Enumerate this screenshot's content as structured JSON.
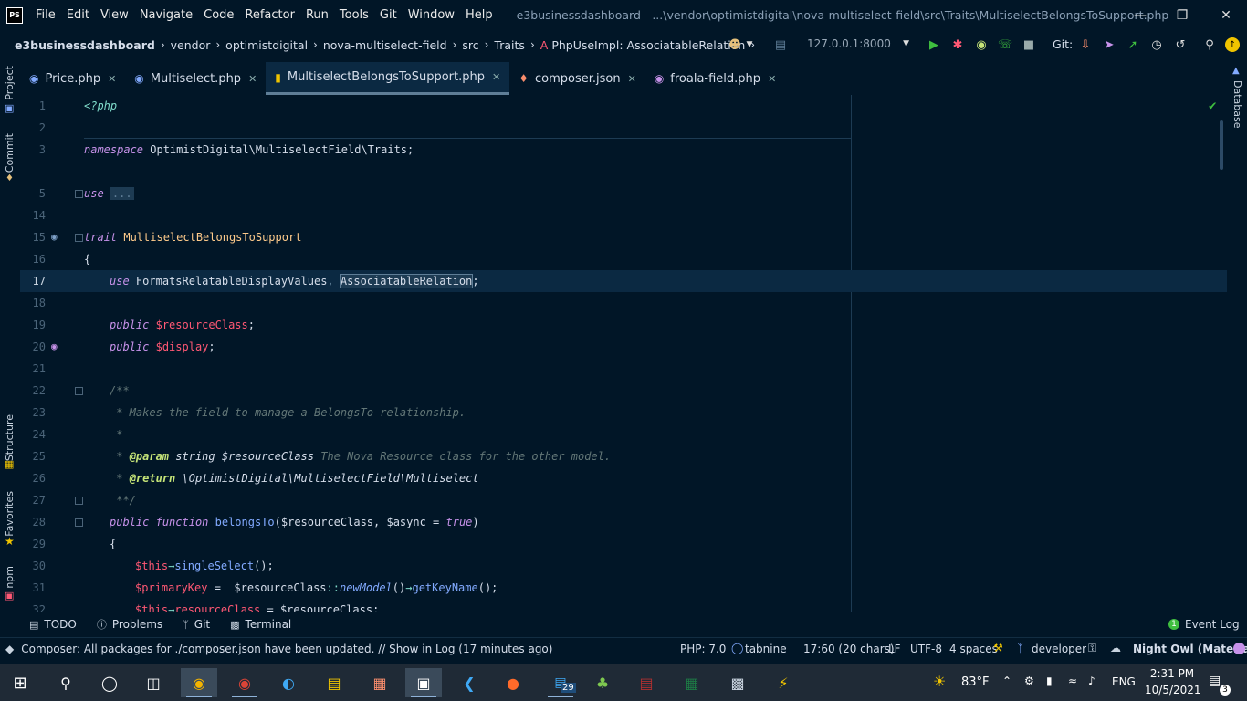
{
  "menubar": {
    "app_logo": "PS",
    "items": [
      "File",
      "Edit",
      "View",
      "Navigate",
      "Code",
      "Refactor",
      "Run",
      "Tools",
      "Git",
      "Window",
      "Help"
    ],
    "window_path": "e3businessdashboard - ...\\vendor\\optimistdigital\\nova-multiselect-field\\src\\Traits\\MultiselectBelongsToSupport.php"
  },
  "navbar": {
    "crumbs": [
      "e3businessdashboard",
      "vendor",
      "optimistdigital",
      "nova-multiselect-field",
      "src",
      "Traits"
    ],
    "symbol": "PhpUseImpl: AssociatableRelation",
    "run_config": "127.0.0.1:8000",
    "git_label": "Git:"
  },
  "tabs": [
    {
      "label": "Price.php",
      "icon": "php-file-icon",
      "active": false
    },
    {
      "label": "Multiselect.php",
      "icon": "php-file-icon",
      "active": false
    },
    {
      "label": "MultiselectBelongsToSupport.php",
      "icon": "trait-file-icon",
      "active": true
    },
    {
      "label": "composer.json",
      "icon": "composer-icon",
      "active": false
    },
    {
      "label": "froala-field.php",
      "icon": "php-file-icon",
      "active": false
    }
  ],
  "left_strip": {
    "project": "Project",
    "commit": "Commit",
    "structure": "Structure",
    "favorites": "Favorites",
    "npm": "npm"
  },
  "right_strip": {
    "database": "Database"
  },
  "editor": {
    "line_numbers": [
      "1",
      "2",
      "3",
      "5",
      "14",
      "15",
      "16",
      "17",
      "18",
      "19",
      "20",
      "21",
      "22",
      "23",
      "24",
      "25",
      "26",
      "27",
      "28",
      "29",
      "30",
      "31",
      "32"
    ],
    "l1": "<?php",
    "l3_kw": "namespace",
    "l3_rest": " OptimistDigital\\MultiselectField\\Traits;",
    "l5_kw": "use",
    "l5_fold": "...",
    "l15_kw": "trait",
    "l15_name": "MultiselectBelongsToSupport",
    "l16": "{",
    "l17_kw": "use",
    "l17_a": "FormatsRelatableDisplayValues",
    "l17_sep": ", ",
    "l17_b": "AssociatableRelation",
    "l17_end": ";",
    "l19_kw": "public",
    "l19_var": "$resourceClass",
    "l20_kw": "public",
    "l20_var": "$display",
    "l22": "/**",
    "l23": " * Makes the field to manage a BelongsTo relationship.",
    "l24": " *",
    "l25_a": " * ",
    "l25_tag": "@param",
    "l25_b": " string $resourceClass",
    "l25_c": " The Nova Resource class for the other model.",
    "l26_a": " * ",
    "l26_tag": "@return",
    "l26_b": " \\OptimistDigital\\MultiselectField\\Multiselect",
    "l27": " **/",
    "l28_kw1": "public",
    "l28_kw2": "function",
    "l28_fn": "belongsTo",
    "l28_args": "($resourceClass, $async = ",
    "l28_true": "true",
    "l28_close": ")",
    "l29": "{",
    "l30_var": "$this",
    "l30_arrow": "→",
    "l30_fn": "singleSelect",
    "l30_end": "();",
    "l31_var": "$primaryKey",
    "l31_eq": " =  $resourceClass",
    "l31_sc": "::",
    "l31_fn": "newModel",
    "l31_mid": "()",
    "l31_arrow": "→",
    "l31_fn2": "getKeyName",
    "l31_end": "();",
    "l32_var": "$this",
    "l32_arrow": "→",
    "l32_prop": "resourceClass",
    "l32_end": " = $resourceClass;"
  },
  "bottom_tools": [
    {
      "label": "TODO",
      "icon": "list-icon"
    },
    {
      "label": "Problems",
      "icon": "info-icon"
    },
    {
      "label": "Git",
      "icon": "branch-icon"
    },
    {
      "label": "Terminal",
      "icon": "terminal-icon"
    }
  ],
  "event_log": {
    "count": "1",
    "label": "Event Log"
  },
  "status": {
    "message": "Composer: All packages for ./composer.json have been updated. // Show in Log (17 minutes ago)",
    "php": "PHP: 7.0",
    "tabnine": "tabnine",
    "position": "17:60 (20 chars)",
    "line_sep": "LF",
    "encoding": "UTF-8",
    "indent": "4 spaces",
    "branch": "developer",
    "theme": "Night Owl (Material)"
  },
  "taskbar": {
    "weather": "83°F",
    "lang": "ENG",
    "time": "2:31 PM",
    "date": "10/5/2021",
    "notifications": "3",
    "calendar_badge": "29"
  },
  "colors": {
    "background": "#011627",
    "keyword": "#c792ea",
    "class": "#ffcb8b",
    "variable": "#ff5874",
    "function": "#82aaff",
    "comment": "#637777"
  }
}
